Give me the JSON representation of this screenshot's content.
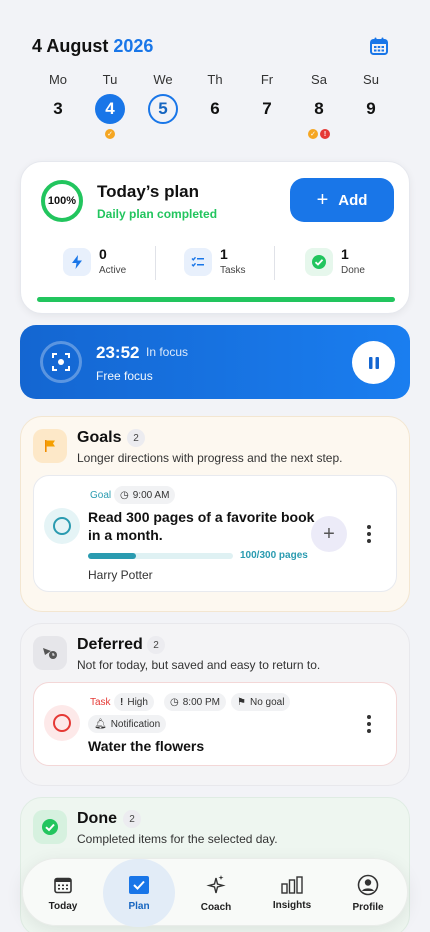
{
  "header": {
    "date_text": "4 August",
    "year_text": "2026"
  },
  "icons": {
    "calendar": "calendar-icon",
    "accent_color": "#1976e8",
    "success_color": "#22c55e"
  },
  "week": [
    {
      "name": "Mo",
      "num": "3"
    },
    {
      "name": "Tu",
      "num": "4"
    },
    {
      "name": "We",
      "num": "5"
    },
    {
      "name": "Th",
      "num": "6"
    },
    {
      "name": "Fr",
      "num": "7"
    },
    {
      "name": "Sa",
      "num": "8"
    },
    {
      "name": "Su",
      "num": "9"
    }
  ],
  "plan": {
    "progress_text": "100%",
    "progress_value": 1.0,
    "title": "Today’s plan",
    "subtitle": "Daily plan completed",
    "add_label": "Add",
    "stats": [
      {
        "value": "0",
        "label": "Active"
      },
      {
        "value": "1",
        "label": "Tasks"
      },
      {
        "value": "1",
        "label": "Done"
      }
    ]
  },
  "focus": {
    "time": "23:52",
    "state": "In focus",
    "label": "Free focus"
  },
  "goals": {
    "title": "Goals",
    "count": "2",
    "subtitle": "Longer directions with progress and the next step.",
    "item": {
      "kind": "Goal",
      "time": "9:00 AM",
      "title_line1": "Read 300 pages of a favorite book",
      "title_line2": "in a month.",
      "progress_text": "100/300 pages",
      "progress_value": 0.333,
      "note": "Harry Potter"
    }
  },
  "deferred": {
    "title": "Deferred",
    "count": "2",
    "subtitle": "Not for today, but saved and easy to return to.",
    "item": {
      "kind": "Task",
      "priority": "High",
      "time": "8:00 PM",
      "goal": "No goal",
      "reminder": "Notification",
      "title": "Water the flowers"
    }
  },
  "done": {
    "title": "Done",
    "count": "2",
    "subtitle": "Completed items for the selected day."
  },
  "nav": [
    {
      "label": "Today"
    },
    {
      "label": "Plan"
    },
    {
      "label": "Coach"
    },
    {
      "label": "Insights"
    },
    {
      "label": "Profile"
    }
  ]
}
